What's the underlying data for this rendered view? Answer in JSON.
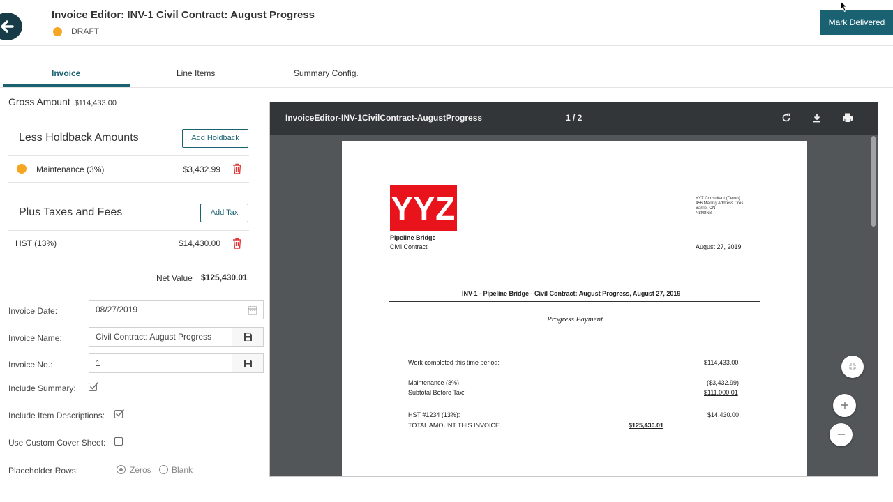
{
  "header": {
    "title": "Invoice Editor: INV-1 Civil Contract: August Progress",
    "status": "DRAFT",
    "status_color": "#f5a623",
    "primary_action": "Mark Delivered",
    "accent_color": "#1a6272"
  },
  "tabs": [
    {
      "label": "Invoice",
      "active": true
    },
    {
      "label": "Line Items",
      "active": false
    },
    {
      "label": "Summary Config.",
      "active": false
    }
  ],
  "summary": {
    "gross_label": "Gross Amount",
    "gross_value": "$114,433.00",
    "holdback_title": "Less Holdback Amounts",
    "add_holdback": "Add Holdback",
    "holdbacks": [
      {
        "label": "Maintenance (3%)",
        "amount": "$3,432.99"
      }
    ],
    "taxes_title": "Plus Taxes and Fees",
    "add_tax": "Add Tax",
    "taxes": [
      {
        "label": "HST (13%)",
        "amount": "$14,430.00"
      }
    ],
    "net_label": "Net Value",
    "net_value": "$125,430.01"
  },
  "form": {
    "invoice_date_label": "Invoice Date:",
    "invoice_date": "08/27/2019",
    "invoice_name_label": "Invoice Name:",
    "invoice_name": "Civil Contract: August Progress",
    "invoice_no_label": "Invoice No.:",
    "invoice_no": "1",
    "include_summary_label": "Include Summary:",
    "include_summary": true,
    "include_desc_label": "Include Item Descriptions:",
    "include_desc": true,
    "custom_cover_label": "Use Custom Cover Sheet:",
    "custom_cover": false,
    "placeholder_rows_label": "Placeholder Rows:",
    "placeholder_options": [
      "Zeros",
      "Blank"
    ],
    "placeholder_selected": "Zeros"
  },
  "viewer": {
    "filename": "InvoiceEditor-INV-1CivilContract-AugustProgress",
    "pages": "1 / 2",
    "icons": [
      "rotate-icon",
      "download-icon",
      "print-icon"
    ]
  },
  "document": {
    "logo_text": "YYZ",
    "logo_color": "#e8131b",
    "project": "Pipeline Bridge",
    "contract": "Civil Contract",
    "company_lines": [
      "YYZ Consultant (Demo)",
      "456 Mailing Address Cres.",
      "Barrie, ON",
      "N8N8N8"
    ],
    "date": "August 27, 2019",
    "heading": "INV-1 - Pipeline Bridge - Civil Contract: August Progress, August 27, 2019",
    "subheading": "Progress Payment",
    "lines": [
      {
        "label": "Work completed this time period:",
        "amount": "$114,433.00"
      },
      {
        "label": "Maintenance (3%)",
        "amount": "($3,432.99)"
      },
      {
        "label": "Subtotal Before Tax:",
        "amount": "$111,000.01"
      },
      {
        "label": "HST #1234 (13%):",
        "amount": "$14,430.00"
      },
      {
        "label": "TOTAL AMOUNT THIS INVOICE",
        "amount": "$125,430.01"
      }
    ]
  }
}
